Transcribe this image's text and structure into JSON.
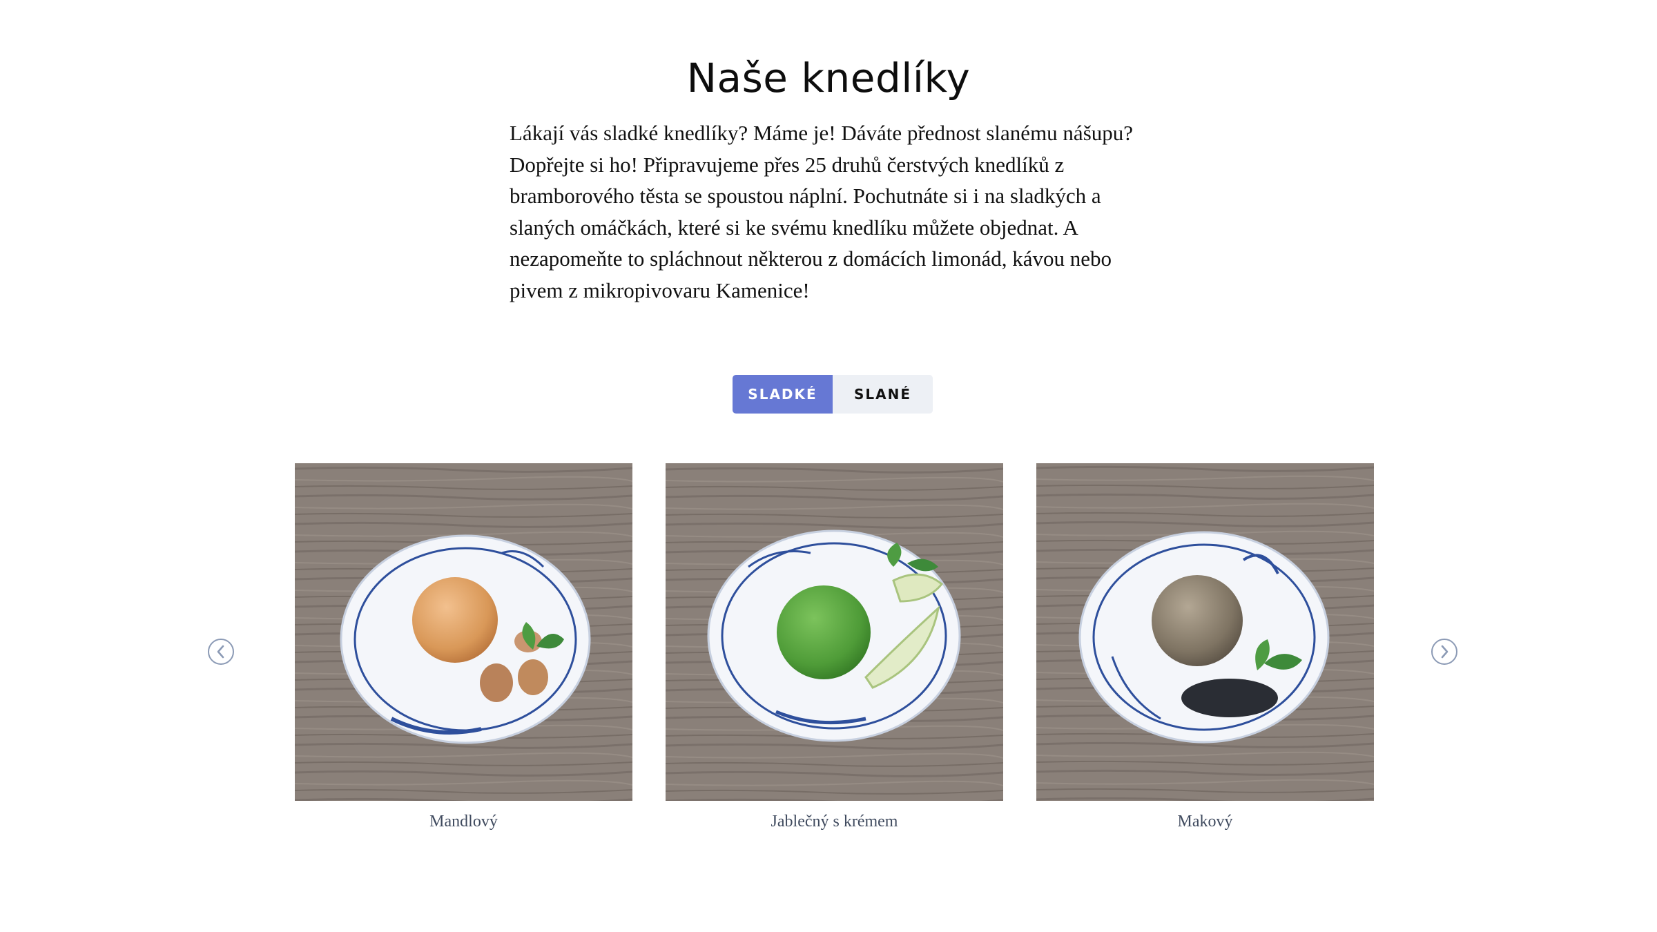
{
  "section": {
    "title": "Naše knedlíky",
    "intro": "Lákají vás sladké knedlíky? Máme je! Dáváte přednost slanému nášupu? Dopřejte si ho! Připravujeme přes 25 druhů čerstvých knedlíků z bramborového těsta se spoustou náplní. Pochutnáte si i na sladkých a slaných omáčkách, které si ke svému knedlíku můžete objednat. A nezapomeňte to spláchnout některou z domácích limonád, kávou nebo pivem z mikropivovaru Kamenice!"
  },
  "tabs": [
    {
      "label": "SLADKÉ",
      "active": true
    },
    {
      "label": "SLANÉ",
      "active": false
    }
  ],
  "carousel": {
    "prev_icon": "chevron-left-circle-icon",
    "next_icon": "chevron-right-circle-icon",
    "items": [
      {
        "label": "Mandlový"
      },
      {
        "label": "Jablečný s krémem"
      },
      {
        "label": "Makový"
      }
    ]
  },
  "colors": {
    "accent": "#6678d4",
    "tab_inactive_bg": "#edf0f5",
    "label_text": "#3f4a5e",
    "arrow": "#8b9ab5"
  }
}
